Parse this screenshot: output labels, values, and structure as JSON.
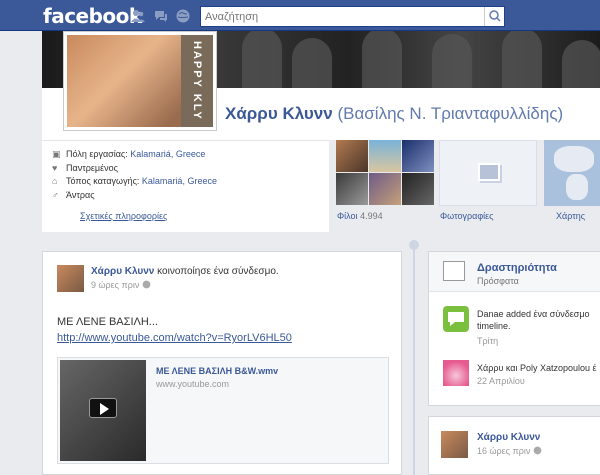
{
  "topbar": {
    "logo": "facebook",
    "search_placeholder": "Αναζήτηση",
    "jewels": [
      "friend-requests-icon",
      "messages-icon",
      "notifications-icon"
    ]
  },
  "profile": {
    "name": "Χάρρυ Κλυνν",
    "alt_name": "(Βασίλης Ν. Τριανταφυλλίδης)",
    "pic_band_text": "HAPPY KLY"
  },
  "info": {
    "work_label": "Πόλη εργασίας:",
    "work_value": "Kalamariá, Greece",
    "relationship": "Παντρεμένος",
    "hometown_label": "Τόπος καταγωγής:",
    "hometown_value": "Kalamariá, Greece",
    "gender": "Άντρας",
    "about_link": "Σχετικές πληροφορίες"
  },
  "tiles": {
    "friends_label": "Φίλοι",
    "friends_count": "4.994",
    "photos_label": "Φωτογραφίες",
    "map_label": "Χάρτης"
  },
  "post": {
    "author": "Χάρρυ Κλυνν",
    "action": "κοινοποίησε ένα σύνδεσμο.",
    "time": "9 ώρες πριν",
    "message": "ΜΕ ΛΕΝΕ ΒΑΣΙΛΗ...",
    "url": "http://www.youtube.com/watch?v=RyorLV6HL50",
    "attachment_title": "ΜΕ ΛΕΝΕ ΒΑΣΙΛΗ B&W.wmv",
    "attachment_domain": "www.youtube.com"
  },
  "activity": {
    "title": "Δραστηριότητα",
    "subtitle": "Πρόσφατα",
    "item1_text": "Danae added ένα σύνδεσμο timeline.",
    "item1_time": "Τρίτη",
    "item2_text": "Χάρρυ και Poly Xatzopoulou έ",
    "item2_time": "22 Απριλίου"
  },
  "post2": {
    "author": "Χάρρυ Κλυνν",
    "time": "16 ώρες πριν"
  }
}
